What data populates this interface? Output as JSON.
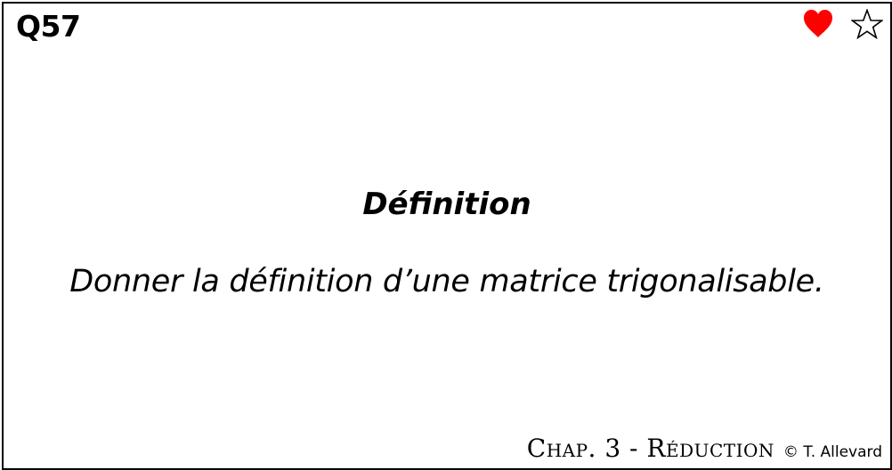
{
  "card": {
    "number": "Q57",
    "heading": "Définition",
    "question": "Donner la définition d’une matrice trigonalisable.",
    "chapter": "Chap. 3 - Réduction",
    "copyright": "© T. Allevard"
  },
  "icons": {
    "heart": {
      "name": "heart-icon",
      "color": "#ff0000"
    },
    "star": {
      "name": "star-outline-icon",
      "color": "#000000"
    }
  }
}
